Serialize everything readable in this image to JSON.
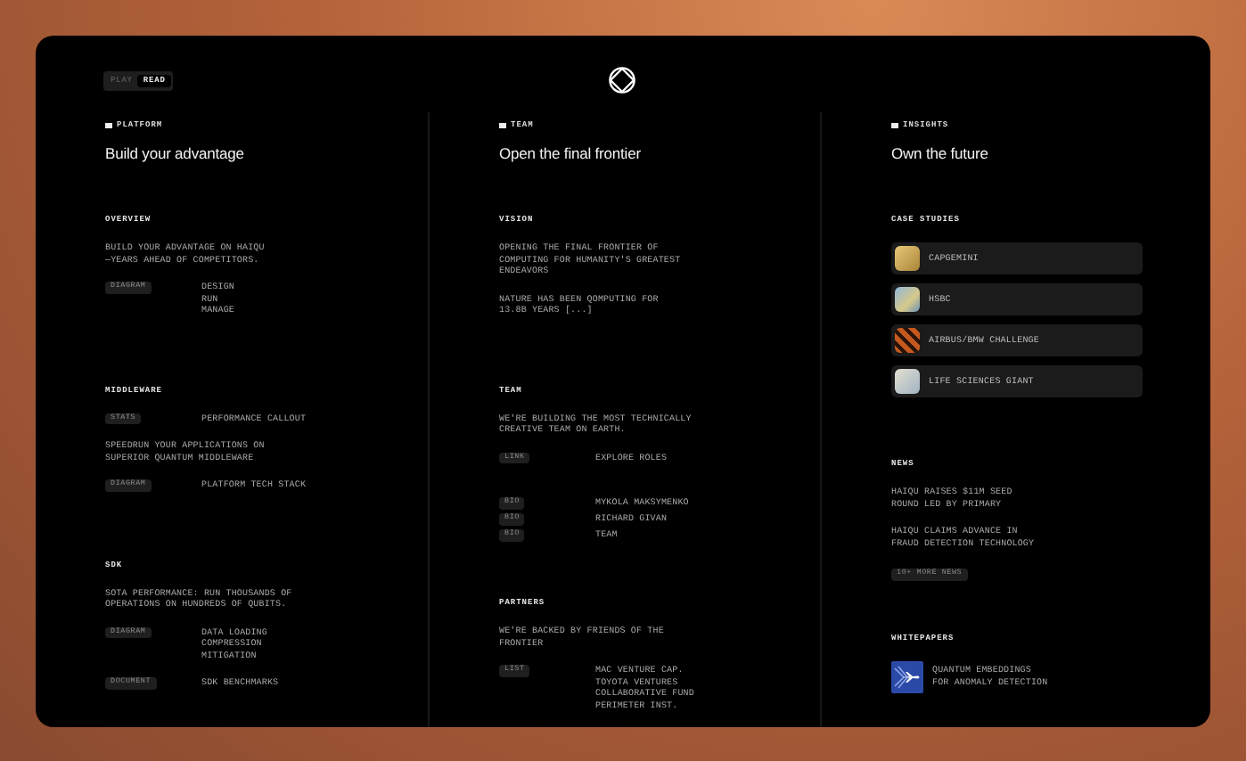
{
  "toggle": [
    {
      "label": "PLAY",
      "selected": false
    },
    {
      "label": "READ",
      "selected": true
    }
  ],
  "columns": [
    {
      "section": "PLATFORM",
      "heading": "Build your advantage",
      "blocks": [
        {
          "title": "OVERVIEW",
          "items": [
            {
              "kind": "text",
              "text": "BUILD YOUR ADVANTAGE ON HAIQU\n—YEARS AHEAD OF COMPETITORS."
            },
            {
              "kind": "tagged",
              "tag": "DIAGRAM",
              "value": "DESIGN\nRUN\nMANAGE"
            }
          ]
        },
        {
          "title": "MIDDLEWARE",
          "items": [
            {
              "kind": "tagged",
              "tag": "STATS",
              "value": "PERFORMANCE CALLOUT"
            },
            {
              "kind": "text",
              "text": "SPEEDRUN YOUR APPLICATIONS ON\nSUPERIOR QUANTUM MIDDLEWARE"
            },
            {
              "kind": "tagged",
              "tag": "DIAGRAM",
              "value": "PLATFORM TECH STACK"
            }
          ]
        },
        {
          "title": "SDK",
          "items": [
            {
              "kind": "text",
              "text": "SOTA PERFORMANCE: RUN THOUSANDS OF\nOPERATIONS ON HUNDREDS OF QUBITS."
            },
            {
              "kind": "tagged",
              "tag": "DIAGRAM",
              "value": "DATA LOADING\nCOMPRESSION\nMITIGATION"
            },
            {
              "kind": "tagged",
              "tag": "DOCUMENT",
              "value": "SDK BENCHMARKS"
            }
          ]
        }
      ]
    },
    {
      "section": "TEAM",
      "heading": "Open the final frontier",
      "blocks": [
        {
          "title": "VISION",
          "items": [
            {
              "kind": "text",
              "text": "OPENING THE FINAL FRONTIER OF\nCOMPUTING FOR HUMANITY'S GREATEST\nENDEAVORS"
            },
            {
              "kind": "text",
              "text": "NATURE HAS BEEN QOMPUTING FOR\n13.8B YEARS [...]"
            }
          ]
        },
        {
          "title": "TEAM",
          "items": [
            {
              "kind": "text",
              "text": "WE'RE BUILDING THE MOST TECHNICALLY\nCREATIVE TEAM ON EARTH."
            },
            {
              "kind": "tagged",
              "tag": "LINK",
              "value": "EXPLORE ROLES"
            },
            {
              "kind": "spacer"
            },
            {
              "kind": "compact",
              "tag": "BIO",
              "value": "MYKOLA MAKSYMENKO"
            },
            {
              "kind": "compact",
              "tag": "BIO",
              "value": "RICHARD GIVAN"
            },
            {
              "kind": "compact",
              "tag": "BIO",
              "value": "TEAM"
            }
          ]
        },
        {
          "title": "PARTNERS",
          "items": [
            {
              "kind": "text",
              "text": "WE'RE BACKED BY FRIENDS OF THE\nFRONTIER"
            },
            {
              "kind": "tagged",
              "tag": "LIST",
              "value": "MAC VENTURE CAP.\nTOYOTA VENTURES\nCOLLABORATIVE FUND\nPERIMETER INST."
            }
          ]
        }
      ]
    },
    {
      "section": "INSIGHTS",
      "heading": "Own the future",
      "blocks": [
        {
          "title": "CASE STUDIES",
          "items": [
            {
              "kind": "case",
              "text": "CAPGEMINI"
            },
            {
              "kind": "case",
              "text": "HSBC"
            },
            {
              "kind": "case",
              "text": "AIRBUS/BMW CHALLENGE"
            },
            {
              "kind": "case",
              "text": "LIFE SCIENCES GIANT"
            }
          ]
        },
        {
          "title": "NEWS",
          "items": [
            {
              "kind": "text",
              "text": "HAIQU RAISES $11M SEED\nROUND LED BY PRIMARY"
            },
            {
              "kind": "text",
              "text": "HAIQU CLAIMS ADVANCE IN\nFRAUD DETECTION TECHNOLOGY"
            },
            {
              "kind": "more",
              "text": "10+ MORE NEWS"
            }
          ]
        },
        {
          "title": "WHITEPAPERS",
          "items": [
            {
              "kind": "paper",
              "text": "QUANTUM EMBEDDINGS\nFOR ANOMALY DETECTION"
            }
          ]
        }
      ]
    }
  ]
}
